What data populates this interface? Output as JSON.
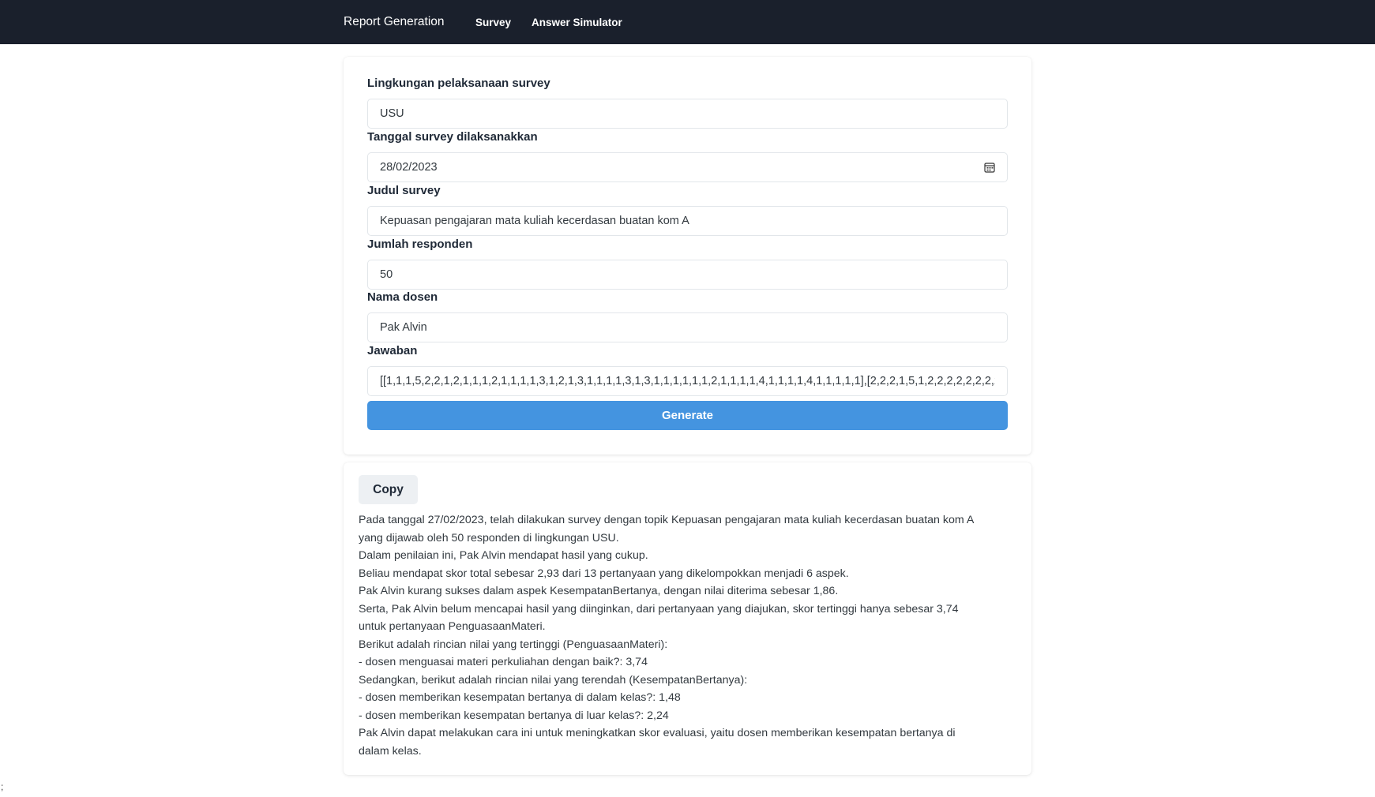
{
  "navbar": {
    "brand": "Report Generation",
    "links": [
      "Survey",
      "Answer Simulator"
    ]
  },
  "form": {
    "fields": {
      "lingkungan": {
        "label": "Lingkungan pelaksanaan survey",
        "value": "USU"
      },
      "tanggal": {
        "label": "Tanggal survey dilaksanakkan",
        "value": "28/02/2023"
      },
      "judul": {
        "label": "Judul survey",
        "value": "Kepuasan pengajaran mata kuliah kecerdasan buatan kom A"
      },
      "jumlah": {
        "label": "Jumlah responden",
        "value": "50"
      },
      "dosen": {
        "label": "Nama dosen",
        "value": "Pak Alvin"
      },
      "jawaban": {
        "label": "Jawaban",
        "value": "[[1,1,1,5,2,2,1,2,1,1,1,2,1,1,1,1,3,1,2,1,3,1,1,1,1,3,1,3,1,1,1,1,1,1,2,1,1,1,1,4,1,1,1,1,4,1,1,1,1,1],[2,2,2,1,5,1,2,2,2,2,2,2,2,2,2,2,"
      }
    },
    "generate_label": "Generate",
    "calendar_icon": "calendar-icon"
  },
  "result": {
    "copy_label": "Copy",
    "lines": [
      "Pada tanggal 27/02/2023, telah dilakukan survey dengan topik Kepuasan pengajaran mata kuliah kecerdasan buatan kom A",
      "yang dijawab oleh 50 responden di lingkungan USU.",
      "Dalam penilaian ini, Pak Alvin mendapat hasil yang cukup.",
      "Beliau mendapat skor total sebesar 2,93 dari 13 pertanyaan yang dikelompokkan menjadi 6 aspek.",
      "Pak Alvin kurang sukses dalam aspek KesempatanBertanya, dengan nilai diterima sebesar 1,86.",
      "Serta, Pak Alvin belum mencapai hasil yang diinginkan, dari pertanyaan yang diajukan, skor tertinggi hanya sebesar 3,74",
      "untuk pertanyaan PenguasaanMateri.",
      "Berikut adalah rincian nilai yang tertinggi (PenguasaanMateri):",
      "- dosen menguasai materi perkuliahan dengan baik?: 3,74",
      "Sedangkan, berikut adalah rincian nilai yang terendah (KesempatanBertanya):",
      "- dosen memberikan kesempatan bertanya di dalam kelas?: 1,48",
      "- dosen memberikan kesempatan bertanya di luar kelas?: 2,24",
      "Pak Alvin dapat melakukan cara ini untuk meningkatkan skor evaluasi, yaitu dosen memberikan kesempatan bertanya di",
      "dalam kelas."
    ]
  },
  "stray_char": ";",
  "colors": {
    "navbar_bg": "#1a202c",
    "primary_button": "#4494e0",
    "copy_button_bg": "#edf0f3"
  }
}
